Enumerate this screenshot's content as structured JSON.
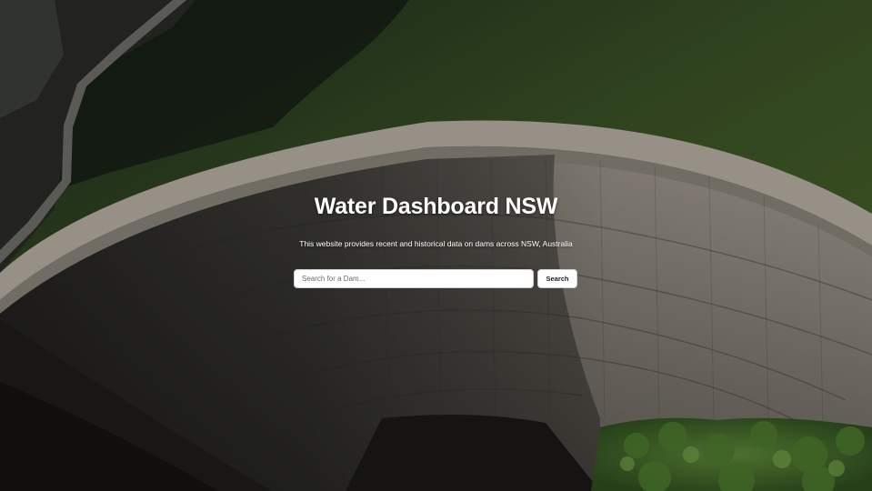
{
  "hero": {
    "background_image": "aerial-dam-reservoir-photo",
    "title": "Water Dashboard NSW",
    "subtitle": "This website provides recent and historical data on dams across NSW, Australia"
  },
  "search": {
    "placeholder": "Search for a Dam...",
    "value": "",
    "button_label": "Search"
  }
}
